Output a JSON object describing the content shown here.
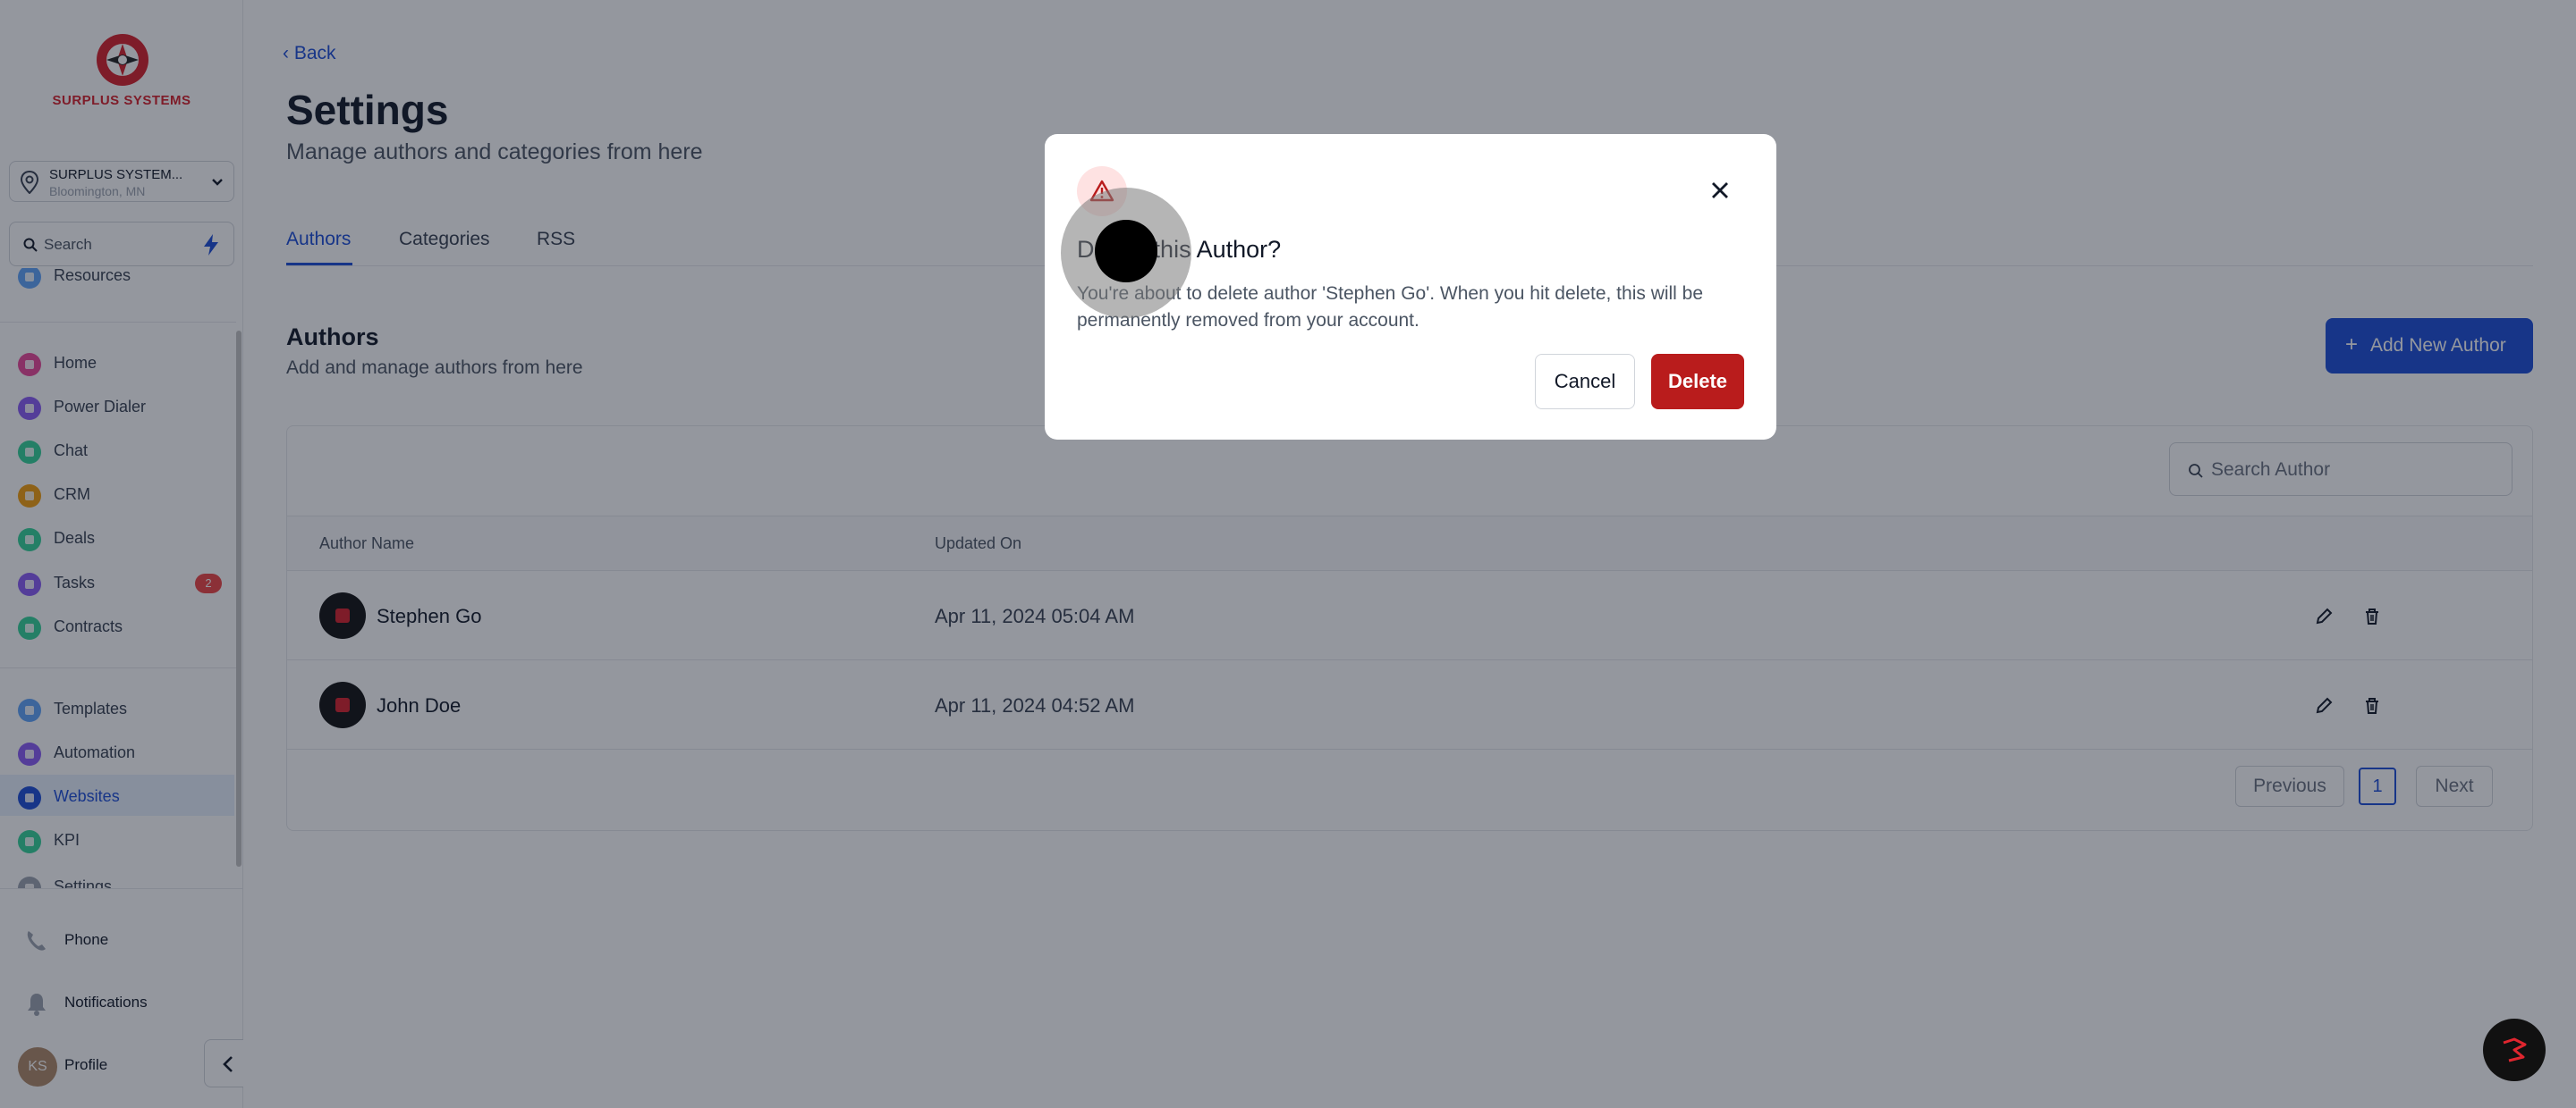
{
  "brand": {
    "name": "SURPLUS SYSTEMS",
    "accent": "#d8202a",
    "primary": "#1d4ed8"
  },
  "location": {
    "name": "SURPLUS SYSTEM...",
    "city": "Bloomington, MN"
  },
  "search": {
    "placeholder": "Search"
  },
  "nav": {
    "partial_top": "Resources",
    "items": [
      {
        "label": "Home",
        "icon": "home-icon",
        "color": "#ec4899"
      },
      {
        "label": "Power Dialer",
        "icon": "phone-icon",
        "color": "#8b5cf6"
      },
      {
        "label": "Chat",
        "icon": "chat-icon",
        "color": "#34d399"
      },
      {
        "label": "CRM",
        "icon": "crm-icon",
        "color": "#f59e0b"
      },
      {
        "label": "Deals",
        "icon": "deals-icon",
        "color": "#34d399"
      },
      {
        "label": "Tasks",
        "icon": "tasks-icon",
        "color": "#8b5cf6",
        "badge": "2"
      },
      {
        "label": "Contracts",
        "icon": "contract-icon",
        "color": "#34d399"
      }
    ],
    "items2": [
      {
        "label": "Templates",
        "icon": "template-icon",
        "color": "#60a5fa"
      },
      {
        "label": "Automation",
        "icon": "automation-icon",
        "color": "#8b5cf6"
      },
      {
        "label": "Websites",
        "icon": "website-icon",
        "color": "#1d4ed8",
        "active": true
      },
      {
        "label": "KPI",
        "icon": "kpi-icon",
        "color": "#34d399"
      }
    ],
    "partial_bottom": "Settings"
  },
  "bottom": {
    "phone": "Phone",
    "notifications": "Notifications",
    "profile": "Profile",
    "initials": "KS"
  },
  "page": {
    "back": "Back",
    "title": "Settings",
    "subtitle": "Manage authors and categories from here",
    "tabs": [
      "Authors",
      "Categories",
      "RSS"
    ]
  },
  "authors": {
    "title": "Authors",
    "subtitle": "Add and manage authors from here",
    "add_button": "Add New Author",
    "search_placeholder": "Search Author",
    "columns": [
      "Author Name",
      "Updated On"
    ],
    "rows": [
      {
        "name": "Stephen Go",
        "updated": "Apr 11, 2024 05:04 AM"
      },
      {
        "name": "John Doe",
        "updated": "Apr 11, 2024 04:52 AM"
      }
    ],
    "pager": {
      "previous": "Previous",
      "page": "1",
      "next": "Next"
    }
  },
  "modal": {
    "title": "Delete this Author?",
    "message": "You're about to delete author 'Stephen Go'. When you hit delete, this will be permanently removed from your account.",
    "cancel": "Cancel",
    "delete": "Delete",
    "danger_color": "#b91c1c"
  }
}
